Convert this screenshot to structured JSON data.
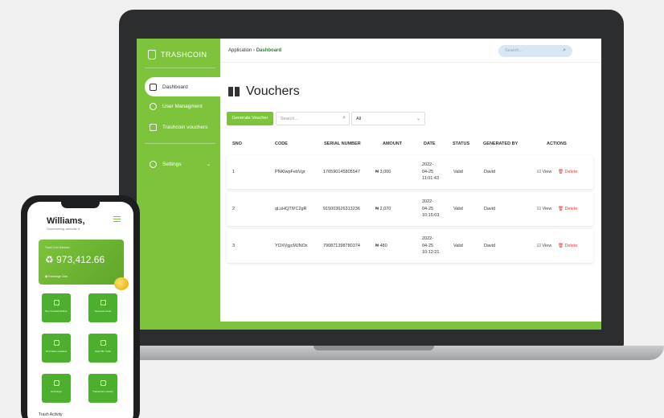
{
  "app": {
    "brand": "TRASHCOIN",
    "accent_color": "#7dc43c"
  },
  "sidebar": {
    "items": [
      {
        "label": "Dashboard",
        "icon": "home-icon"
      },
      {
        "label": "User Managment",
        "icon": "user-icon"
      },
      {
        "label": "Trashcoin vouchers",
        "icon": "document-icon"
      }
    ],
    "settings": {
      "label": "Settings",
      "icon": "gear-icon"
    }
  },
  "header": {
    "breadcrumb_root": "Application",
    "breadcrumb_sep": "›",
    "breadcrumb_current": "Dashboard",
    "search_placeholder": "Search..."
  },
  "main": {
    "title": "Vouchers",
    "generate_label": "Generate Voucher",
    "search_placeholder": "Search...",
    "filter_value": "All",
    "columns": [
      "SNO",
      "CODE",
      "SERIAL NUMBER",
      "AMOUNT",
      "DATE",
      "STATUS",
      "GENERATED BY",
      "ACTIONS"
    ],
    "rows": [
      {
        "sno": "1",
        "code": "PNKlwpFebVgr",
        "serial": "176590145805547",
        "amount": "₦ 3,000",
        "date1": "2022-",
        "date2": "04-25",
        "date3": "11:01:43",
        "status": "Valid",
        "by": "David"
      },
      {
        "sno": "2",
        "code": "qLuHQTiVC2gR",
        "serial": "915003626313236",
        "amount": "₦ 2,070",
        "date1": "2022-",
        "date2": "04-25",
        "date3": "10:15:03",
        "status": "Valid",
        "by": "David"
      },
      {
        "sno": "3",
        "code": "YOXVgjcMJNOx",
        "serial": "790871398780374",
        "amount": "₦ 480",
        "date1": "2022-",
        "date2": "04-25",
        "date3": "10:12:21",
        "status": "Valid",
        "by": "David"
      }
    ],
    "view_label": "View",
    "delete_label": "Delete"
  },
  "phone": {
    "greeting": "Williams,",
    "subtitle": "Good evening, welcome ☀",
    "balance_label": "Trash Coin Balance",
    "balance": "973,412.66",
    "exchange_label": "Exchange Coin",
    "tiles": [
      "Buy Voucher/Airtime",
      "Generate Code",
      "Find Safe Locations",
      "Scan Bin Code",
      "Exchange",
      "Transaction History"
    ],
    "footer": "Trash Activity"
  }
}
